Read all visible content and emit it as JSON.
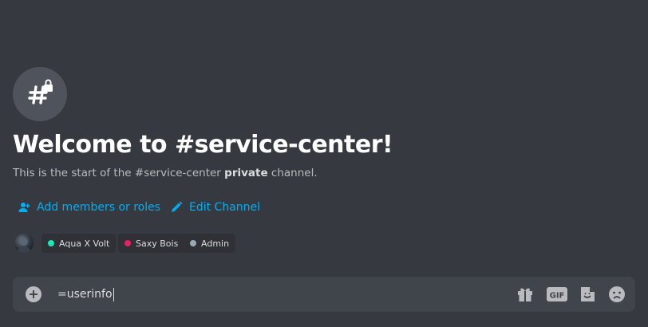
{
  "channel": {
    "icon": "hashtag-lock-icon",
    "welcome_title": "Welcome to #service-center!",
    "subtitle_prefix": "This is the start of the #service-center",
    "subtitle_emphasis": "private",
    "subtitle_suffix": "channel."
  },
  "actions": {
    "add_members_label": "Add members or roles",
    "add_members_icon": "person-add-icon",
    "edit_channel_label": "Edit Channel",
    "edit_channel_icon": "pencil-icon"
  },
  "roles": [
    {
      "name": "Aqua X Volt",
      "color": "#1de9b6"
    },
    {
      "name": "Saxy Bois",
      "color": "#e91e63"
    },
    {
      "name": "Admin",
      "color": "#99aab5"
    }
  ],
  "composer": {
    "value": "=userinfo",
    "icons": [
      "plus-circle-icon",
      "gift-icon",
      "gif-icon",
      "sticker-icon",
      "emoji-icon"
    ],
    "gif_label": "GIF"
  },
  "colors": {
    "background": "#36393f",
    "link": "#00aff4",
    "composer_bg": "#40444b"
  }
}
